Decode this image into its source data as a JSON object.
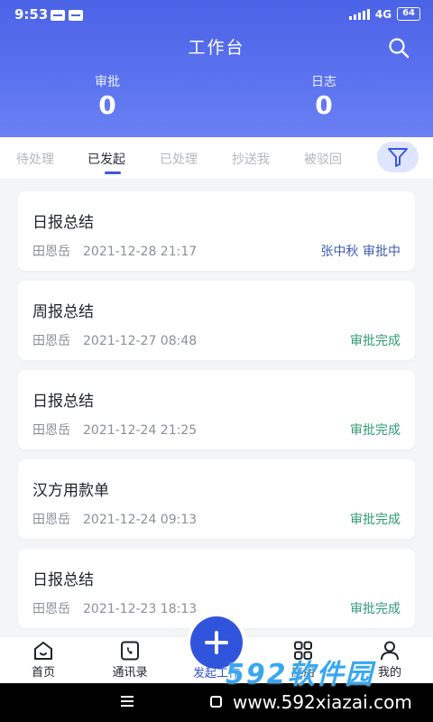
{
  "status_bar": {
    "time": "9:53",
    "network": "4G",
    "battery": "64"
  },
  "header": {
    "title": "工作台",
    "stats": [
      {
        "label": "审批",
        "value": "0"
      },
      {
        "label": "日志",
        "value": "0"
      }
    ]
  },
  "tabs": [
    {
      "label": "待处理",
      "active": false
    },
    {
      "label": "已发起",
      "active": true
    },
    {
      "label": "已处理",
      "active": false
    },
    {
      "label": "抄送我",
      "active": false
    },
    {
      "label": "被驳回",
      "active": false
    }
  ],
  "records": [
    {
      "title": "日报总结",
      "person": "田恩岳",
      "datetime": "2021-12-28 21:17",
      "status": "张中秋 审批中",
      "status_color": "#3c5bb0"
    },
    {
      "title": "周报总结",
      "person": "田恩岳",
      "datetime": "2021-12-27 08:48",
      "status": "审批完成",
      "status_color": "#2f9b72"
    },
    {
      "title": "日报总结",
      "person": "田恩岳",
      "datetime": "2021-12-24 21:25",
      "status": "审批完成",
      "status_color": "#2f9b72"
    },
    {
      "title": "汉方用款单",
      "person": "田恩岳",
      "datetime": "2021-12-24 09:13",
      "status": "审批完成",
      "status_color": "#2f9b72"
    },
    {
      "title": "日报总结",
      "person": "田恩岳",
      "datetime": "2021-12-23 18:13",
      "status": "审批完成",
      "status_color": "#2f9b72"
    }
  ],
  "bottom_nav": {
    "home": "首页",
    "contacts": "通讯录",
    "start": "发起工作",
    "apps": "应用",
    "profile": "我的"
  },
  "watermark": {
    "logo": "592软件园",
    "site": "www.592xiazai.com"
  },
  "colors": {
    "accent": "#3154dc",
    "header": "#4b63e6",
    "approved": "#2f9b72",
    "pending": "#3c5bb0"
  }
}
